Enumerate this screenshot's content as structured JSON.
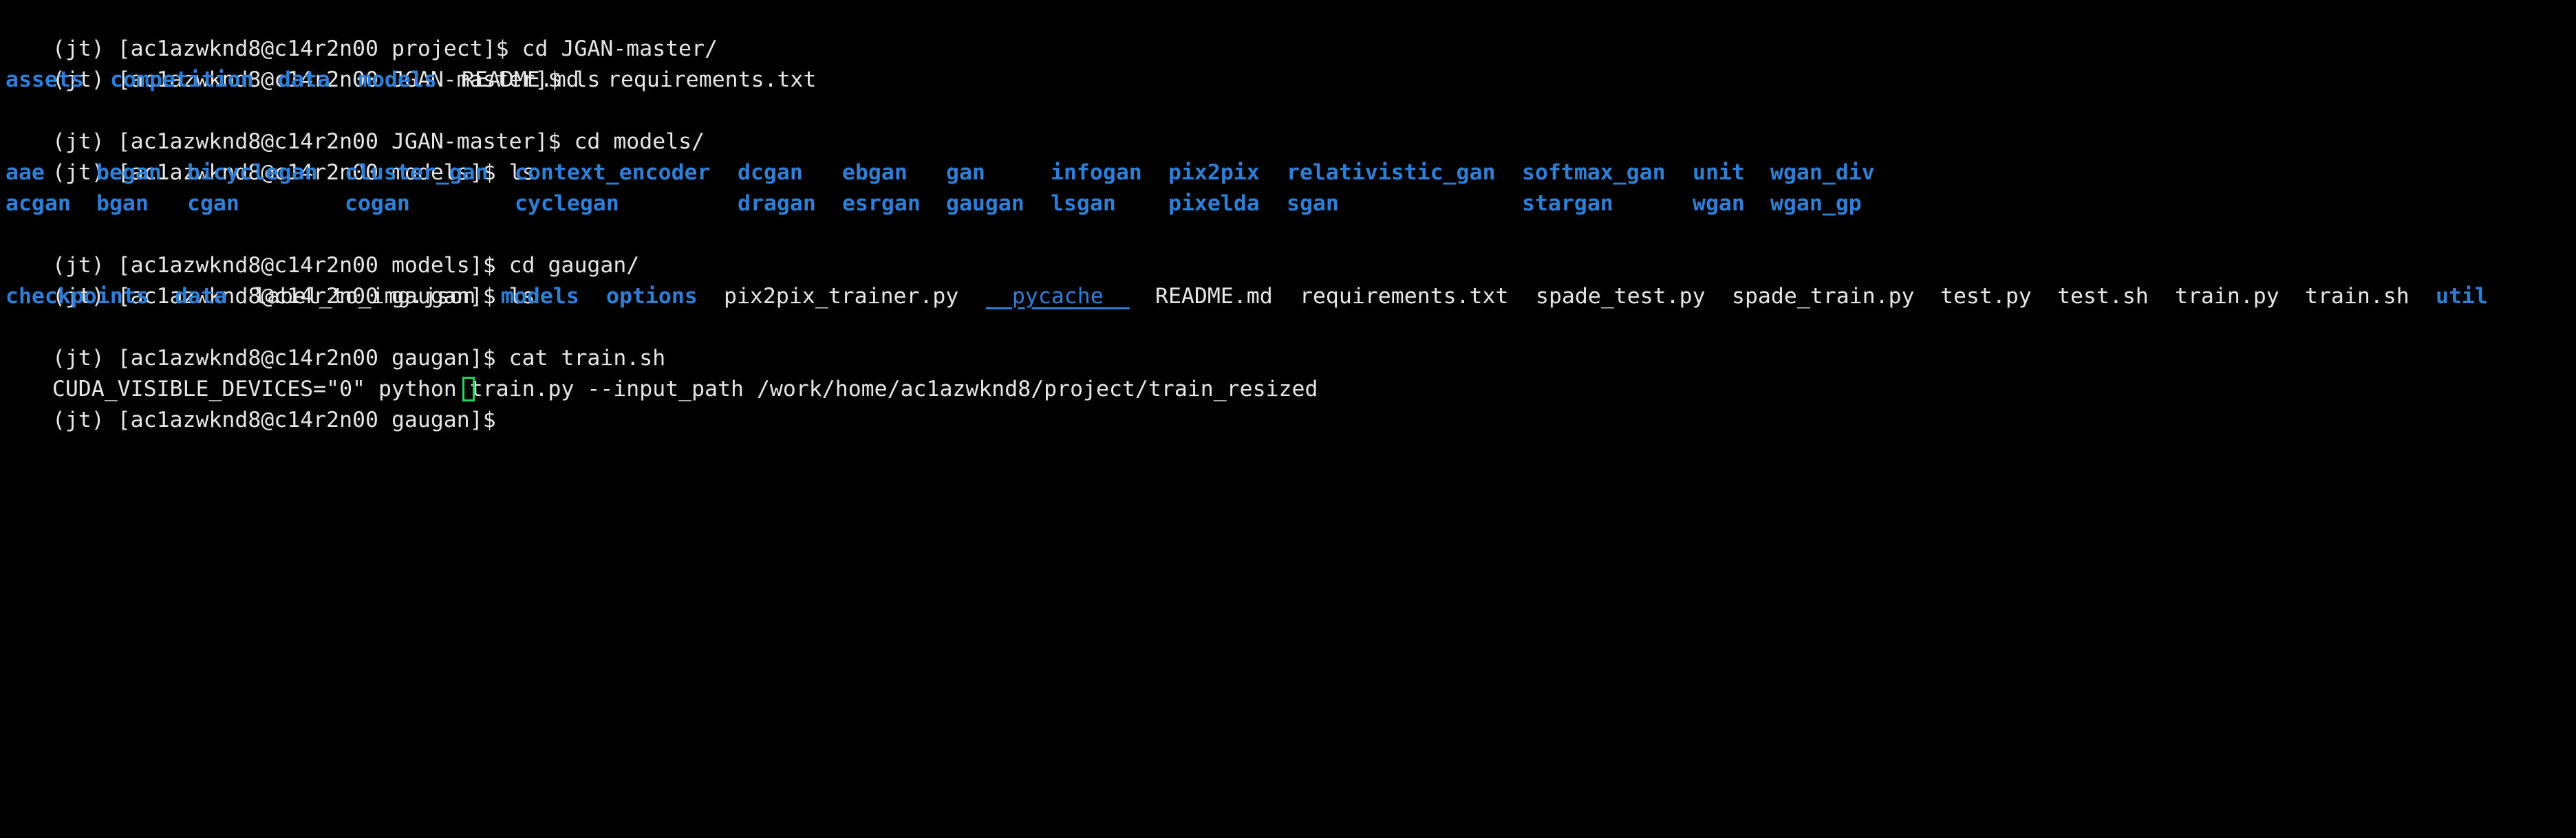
{
  "colors": {
    "background": "#000000",
    "text": "#e6e6e6",
    "directory": "#2f7fd6",
    "cursor": "#1ed760"
  },
  "prompts": [
    "(jt) [ac1azwknd8@c14r2n00 project]$ cd JGAN-master/",
    "(jt) [ac1azwknd8@c14r2n00 JGAN-master]$ ls",
    "(jt) [ac1azwknd8@c14r2n00 JGAN-master]$ cd models/",
    "(jt) [ac1azwknd8@c14r2n00 models]$ ls",
    "(jt) [ac1azwknd8@c14r2n00 models]$ cd gaugan/",
    "(jt) [ac1azwknd8@c14r2n00 gaugan]$ ls",
    "(jt) [ac1azwknd8@c14r2n00 gaugan]$ cat train.sh",
    "(jt) [ac1azwknd8@c14r2n00 gaugan]$ "
  ],
  "ls_jgan_master": [
    {
      "name": "assets",
      "kind": "dir"
    },
    {
      "name": "competition",
      "kind": "dir"
    },
    {
      "name": "data",
      "kind": "dir"
    },
    {
      "name": "models",
      "kind": "dir"
    },
    {
      "name": "README.md",
      "kind": "file"
    },
    {
      "name": "requirements.txt",
      "kind": "file"
    }
  ],
  "ls_models_row1": [
    "aae",
    "began",
    "bicyclegan",
    "cluster_gan",
    "context_encoder",
    "dcgan",
    "ebgan",
    "gan",
    "infogan",
    "pix2pix",
    "relativistic_gan",
    "softmax_gan",
    "unit",
    "wgan_div"
  ],
  "ls_models_row2": [
    "acgan",
    "bgan",
    "cgan",
    "cogan",
    "cyclegan",
    "dragan",
    "esrgan",
    "gaugan",
    "lsgan",
    "pixelda",
    "sgan",
    "stargan",
    "wgan",
    "wgan_gp"
  ],
  "ls_gaugan": [
    {
      "name": "checkpoints",
      "kind": "dir"
    },
    {
      "name": "data",
      "kind": "dir"
    },
    {
      "name": "label_to_img.json",
      "kind": "file"
    },
    {
      "name": "models",
      "kind": "dir"
    },
    {
      "name": "options",
      "kind": "dir"
    },
    {
      "name": "pix2pix_trainer.py",
      "kind": "file"
    },
    {
      "name": "__pycache__",
      "kind": "dirline"
    },
    {
      "name": "README.md",
      "kind": "file"
    },
    {
      "name": "requirements.txt",
      "kind": "file"
    },
    {
      "name": "spade_test.py",
      "kind": "file"
    },
    {
      "name": "spade_train.py",
      "kind": "file"
    },
    {
      "name": "test.py",
      "kind": "file"
    },
    {
      "name": "test.sh",
      "kind": "file"
    },
    {
      "name": "train.py",
      "kind": "file"
    },
    {
      "name": "train.sh",
      "kind": "file"
    },
    {
      "name": "util",
      "kind": "dir"
    }
  ],
  "train_sh_contents": "CUDA_VISIBLE_DEVICES=\"0\" python train.py --input_path /work/home/ac1azwknd8/project/train_resized",
  "cursor_icon": "block-cursor-icon"
}
